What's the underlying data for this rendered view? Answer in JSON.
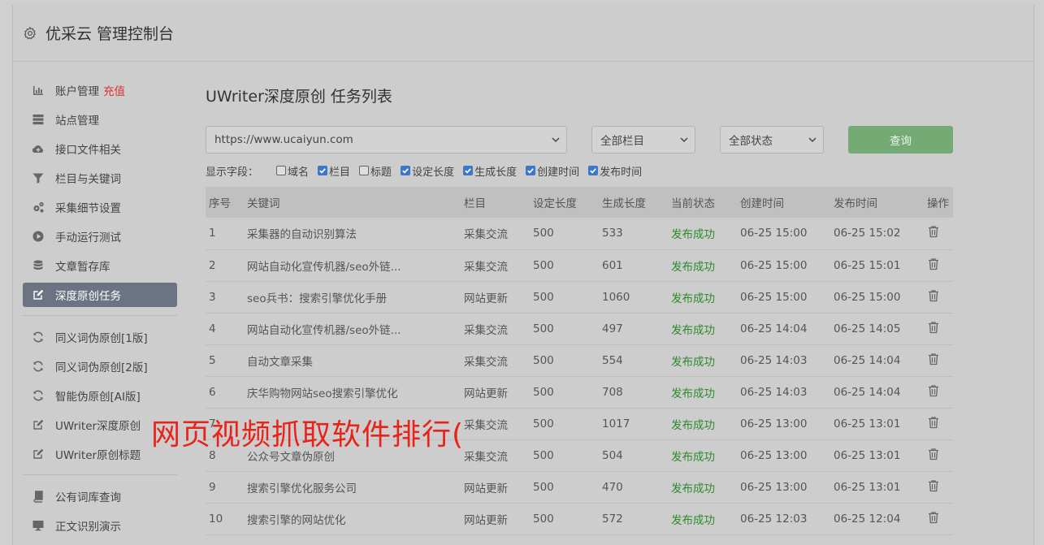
{
  "header": {
    "title": "优采云 管理控制台"
  },
  "sidebar": {
    "items": [
      {
        "label": "账户管理",
        "extra": "充值",
        "icon": "bar-chart-icon"
      },
      {
        "label": "站点管理",
        "icon": "server-icon"
      },
      {
        "label": "接口文件相关",
        "icon": "cloud-upload-icon"
      },
      {
        "label": "栏目与关键词",
        "icon": "filter-icon"
      },
      {
        "label": "采集细节设置",
        "icon": "cogs-icon"
      },
      {
        "label": "手动运行测试",
        "icon": "play-circle-icon"
      },
      {
        "label": "文章暂存库",
        "icon": "database-icon"
      },
      {
        "label": "深度原创任务",
        "icon": "edit-icon",
        "active": true
      }
    ],
    "items2": [
      {
        "label": "同义词伪原创[1版]",
        "icon": "refresh-icon"
      },
      {
        "label": "同义词伪原创[2版]",
        "icon": "refresh-icon"
      },
      {
        "label": "智能伪原创[AI版]",
        "icon": "refresh-icon"
      },
      {
        "label": "UWriter深度原创",
        "icon": "edit-icon"
      },
      {
        "label": "UWriter原创标题",
        "icon": "edit-icon"
      }
    ],
    "items3": [
      {
        "label": "公有词库查询",
        "icon": "book-icon"
      },
      {
        "label": "正文识别演示",
        "icon": "desktop-icon"
      }
    ]
  },
  "main": {
    "title": "UWriter深度原创 任务列表",
    "site_select": "https://www.ucaiyun.com",
    "column_select": "全部栏目",
    "status_select": "全部状态",
    "query_label": "查询",
    "fields_label": "显示字段：",
    "fields": [
      {
        "label": "域名",
        "checked": false
      },
      {
        "label": "栏目",
        "checked": true
      },
      {
        "label": "标题",
        "checked": false
      },
      {
        "label": "设定长度",
        "checked": true
      },
      {
        "label": "生成长度",
        "checked": true
      },
      {
        "label": "创建时间",
        "checked": true
      },
      {
        "label": "发布时间",
        "checked": true
      }
    ],
    "table": {
      "headers": [
        "序号",
        "关键词",
        "栏目",
        "设定长度",
        "生成长度",
        "当前状态",
        "创建时间",
        "发布时间",
        "操作"
      ],
      "rows": [
        [
          "1",
          "采集器的自动识别算法",
          "采集交流",
          "500",
          "533",
          "发布成功",
          "06-25 15:00",
          "06-25 15:02"
        ],
        [
          "2",
          "网站自动化宣传机器/seo外链...",
          "采集交流",
          "500",
          "601",
          "发布成功",
          "06-25 15:00",
          "06-25 15:01"
        ],
        [
          "3",
          "seo兵书：搜索引擎优化手册",
          "网站更新",
          "500",
          "1060",
          "发布成功",
          "06-25 15:00",
          "06-25 15:00"
        ],
        [
          "4",
          "网站自动化宣传机器/seo外链...",
          "采集交流",
          "500",
          "497",
          "发布成功",
          "06-25 14:04",
          "06-25 14:05"
        ],
        [
          "5",
          "自动文章采集",
          "采集交流",
          "500",
          "554",
          "发布成功",
          "06-25 14:03",
          "06-25 14:04"
        ],
        [
          "6",
          "庆华购物网站seo搜索引擎优化",
          "网站更新",
          "500",
          "708",
          "发布成功",
          "06-25 14:03",
          "06-25 14:04"
        ],
        [
          "7",
          "",
          "采集交流",
          "500",
          "1017",
          "发布成功",
          "06-25 13:00",
          "06-25 13:01"
        ],
        [
          "8",
          "公众号文章伪原创",
          "采集交流",
          "500",
          "504",
          "发布成功",
          "06-25 13:00",
          "06-25 13:01"
        ],
        [
          "9",
          "搜索引擎优化服务公司",
          "网站更新",
          "500",
          "470",
          "发布成功",
          "06-25 13:00",
          "06-25 13:01"
        ],
        [
          "10",
          "搜索引擎的网站优化",
          "网站更新",
          "500",
          "572",
          "发布成功",
          "06-25 12:03",
          "06-25 12:04"
        ]
      ]
    }
  },
  "watermark": "网页视频抓取软件排行(",
  "colors": {
    "active_nav": "#6c7483",
    "query_button": "#74ab74",
    "status_success": "#2d8a2d",
    "recharge": "#e03131",
    "watermark": "#e8231a"
  }
}
